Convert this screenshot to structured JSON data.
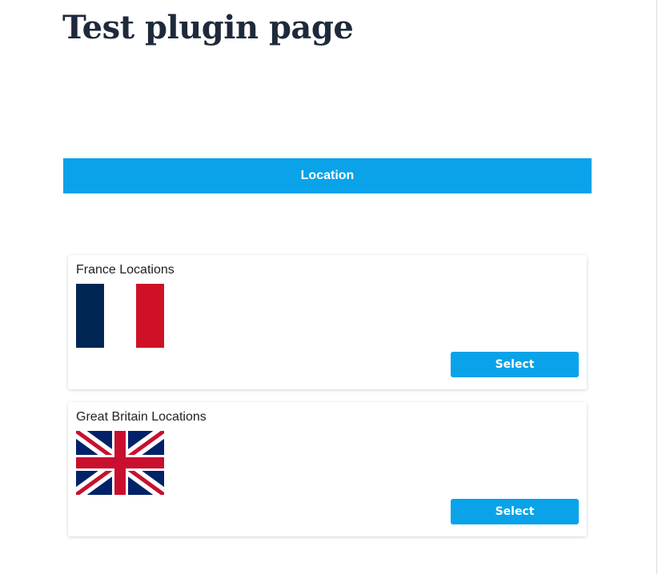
{
  "page": {
    "title": "Test plugin page"
  },
  "location_bar": {
    "label": "Location"
  },
  "locations": [
    {
      "title": "France Locations",
      "flag": "france-flag",
      "button_label": "Select"
    },
    {
      "title": "Great Britain Locations",
      "flag": "united-kingdom-flag",
      "button_label": "Select"
    }
  ],
  "colors": {
    "accent": "#0aa3e9",
    "title_text": "#1e2a3b",
    "france_blue": "#002654",
    "france_red": "#ce1126",
    "uk_blue": "#012169",
    "uk_red": "#c8102e"
  }
}
